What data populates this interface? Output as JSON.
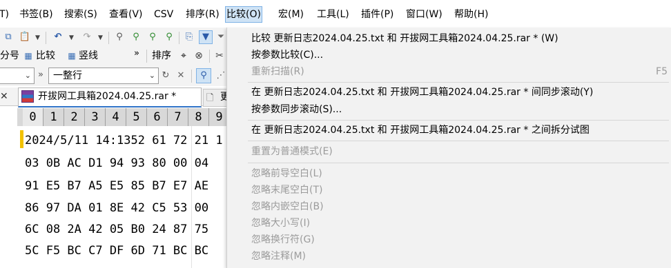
{
  "menubar": {
    "items": [
      {
        "label": "T)",
        "active": false
      },
      {
        "label": "书签(B)",
        "active": false
      },
      {
        "label": "搜索(S)",
        "active": false
      },
      {
        "label": "查看(V)",
        "active": false
      },
      {
        "label": "CSV",
        "active": false
      },
      {
        "label": "排序(R)",
        "active": false
      },
      {
        "label": "比较(O)",
        "active": true
      },
      {
        "label": "宏(M)",
        "active": false
      },
      {
        "label": "工具(L)",
        "active": false
      },
      {
        "label": "插件(P)",
        "active": false
      },
      {
        "label": "窗口(W)",
        "active": false
      },
      {
        "label": "帮助(H)",
        "active": false
      }
    ]
  },
  "toolbar2": {
    "rowno_label": "分号",
    "compare_label": "比较",
    "vline_label": "竖线",
    "sort_label": "排序",
    "more_glyph": "»"
  },
  "toolbar3": {
    "combo_left_value": "",
    "combo_main_value": "一整行",
    "more_glyph": "»"
  },
  "tabs": {
    "active_label": "开拔网工具箱2024.04.25.rar *",
    "inactive_label": "更"
  },
  "ruler": {
    "cells": [
      "0",
      "1",
      "2",
      "3",
      "4",
      "5",
      "6",
      "7",
      "8",
      "9"
    ]
  },
  "hex_lines": [
    "2024/5/11 14:1352 61 72 21 1",
    "03 0B AC D1 94 93 80 00 04",
    "91 E5 B7 A5 E5 85 B7 E7 AE",
    "86 97 DA 01 8E 42 C5 53 00",
    "6C 08 2A 42 05 B0 24 87 75",
    "5C F5 BC C7 DF 6D 71 BC BC"
  ],
  "dropdown": {
    "item_compare_files": "比较 更新日志2024.04.25.txt 和 开拔网工具箱2024.04.25.rar * (W)",
    "item_compare_params": "按参数比较(C)...",
    "item_rescan": "重新扫描(R)",
    "item_rescan_shortcut": "F5",
    "item_sync_scroll": "在 更新日志2024.04.25.txt 和 开拔网工具箱2024.04.25.rar * 间同步滚动(Y)",
    "item_sync_scroll_params": "按参数同步滚动(S)...",
    "item_split_view": "在 更新日志2024.04.25.txt 和 开拔网工具箱2024.04.25.rar * 之间拆分试图",
    "item_reset_normal": "重置为普通模式(E)",
    "item_ignore_leading": "忽略前导空白(L)",
    "item_ignore_trailing": "忽略末尾空白(T)",
    "item_ignore_embedded": "忽略内嵌空白(B)",
    "item_ignore_case": "忽略大小写(I)",
    "item_ignore_newline": "忽略换行符(G)",
    "item_ignore_comments": "忽略注释(M)"
  },
  "colors": {
    "menu_highlight": "#cfe3f5",
    "tab_underline": "#2f73c8",
    "caret_marker": "#f2c200",
    "disabled_text": "#9b9b9b"
  }
}
